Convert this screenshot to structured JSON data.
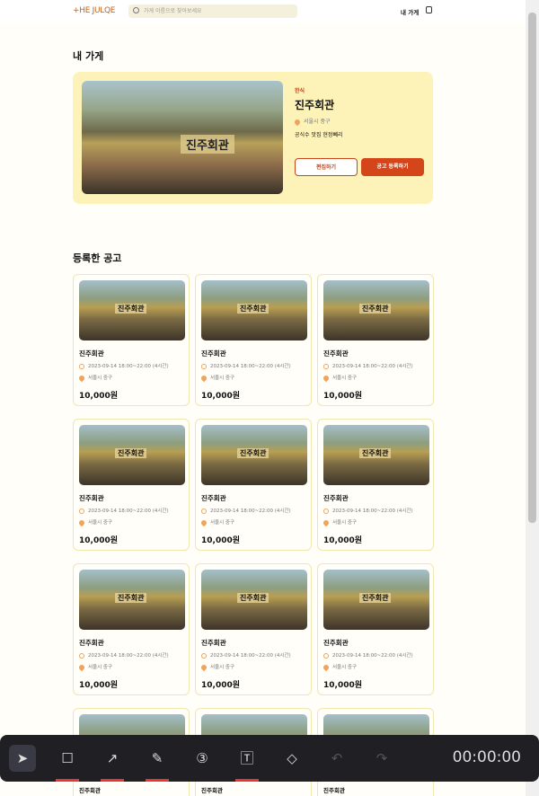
{
  "nav": {
    "logo": "+HE JULQE",
    "search_placeholder": "가게 이름으로 찾아보세요",
    "my_store": "내 가게"
  },
  "my_store": {
    "heading": "내 가게",
    "category": "한식",
    "name": "진주회관",
    "address": "서울시 중구",
    "description": "공식수 맛집 현정뻬리",
    "sign": "진주회관",
    "edit_label": "편집하기",
    "register_label": "공고 등록하기"
  },
  "notices": {
    "heading": "등록한 공고",
    "items": [
      {
        "name": "진주회관",
        "datetime": "2023-09-14 18:00~22:00 (4시간)",
        "address": "서울시 중구",
        "price": "10,000원"
      }
    ]
  },
  "toolbar": {
    "timer": "00:00:00"
  }
}
